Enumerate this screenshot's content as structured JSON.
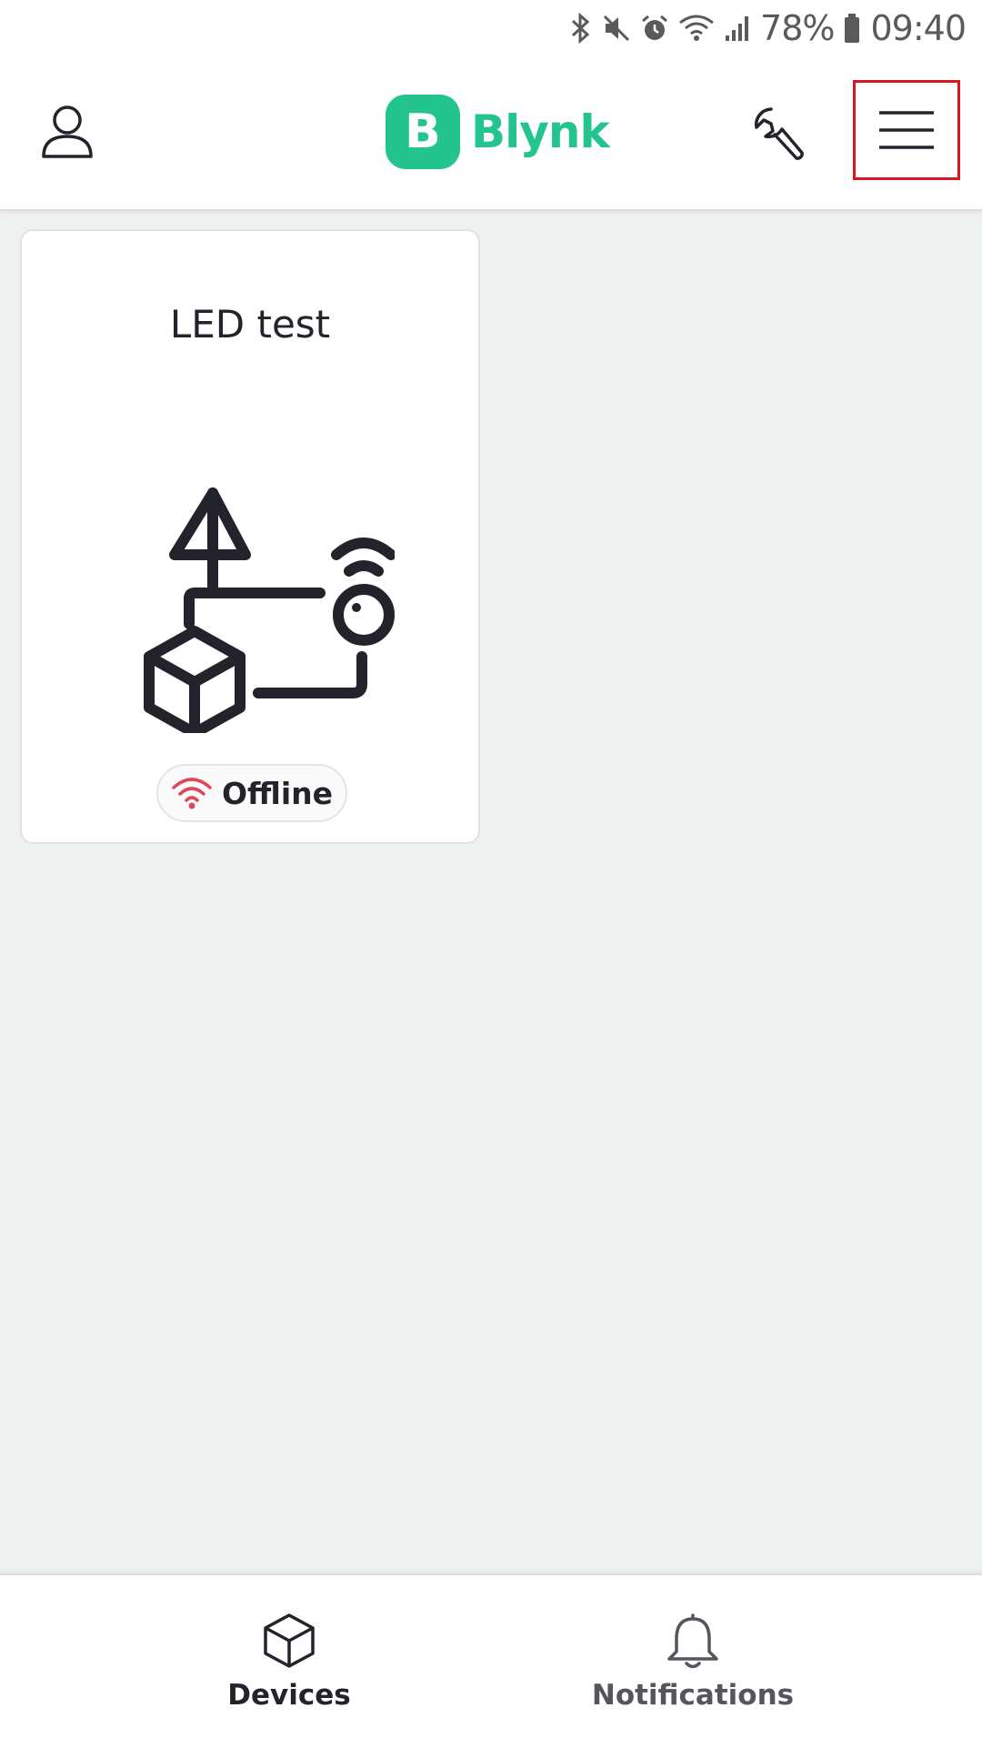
{
  "status_bar": {
    "battery_text": "78%",
    "time": "09:40",
    "icons": [
      "bluetooth-icon",
      "mute-icon",
      "alarm-icon",
      "wifi-icon",
      "signal-icon",
      "battery-icon"
    ]
  },
  "header": {
    "logo_letter": "B",
    "logo_text": "Blynk",
    "brand_color": "#23c48e",
    "highlight_color": "#d7191f"
  },
  "devices": [
    {
      "name": "LED test",
      "status": "Offline",
      "status_color": "#e0475a"
    }
  ],
  "bottom_nav": {
    "tabs": [
      {
        "label": "Devices",
        "icon": "cube-icon",
        "active": true
      },
      {
        "label": "Notifications",
        "icon": "bell-icon",
        "active": false
      }
    ]
  }
}
